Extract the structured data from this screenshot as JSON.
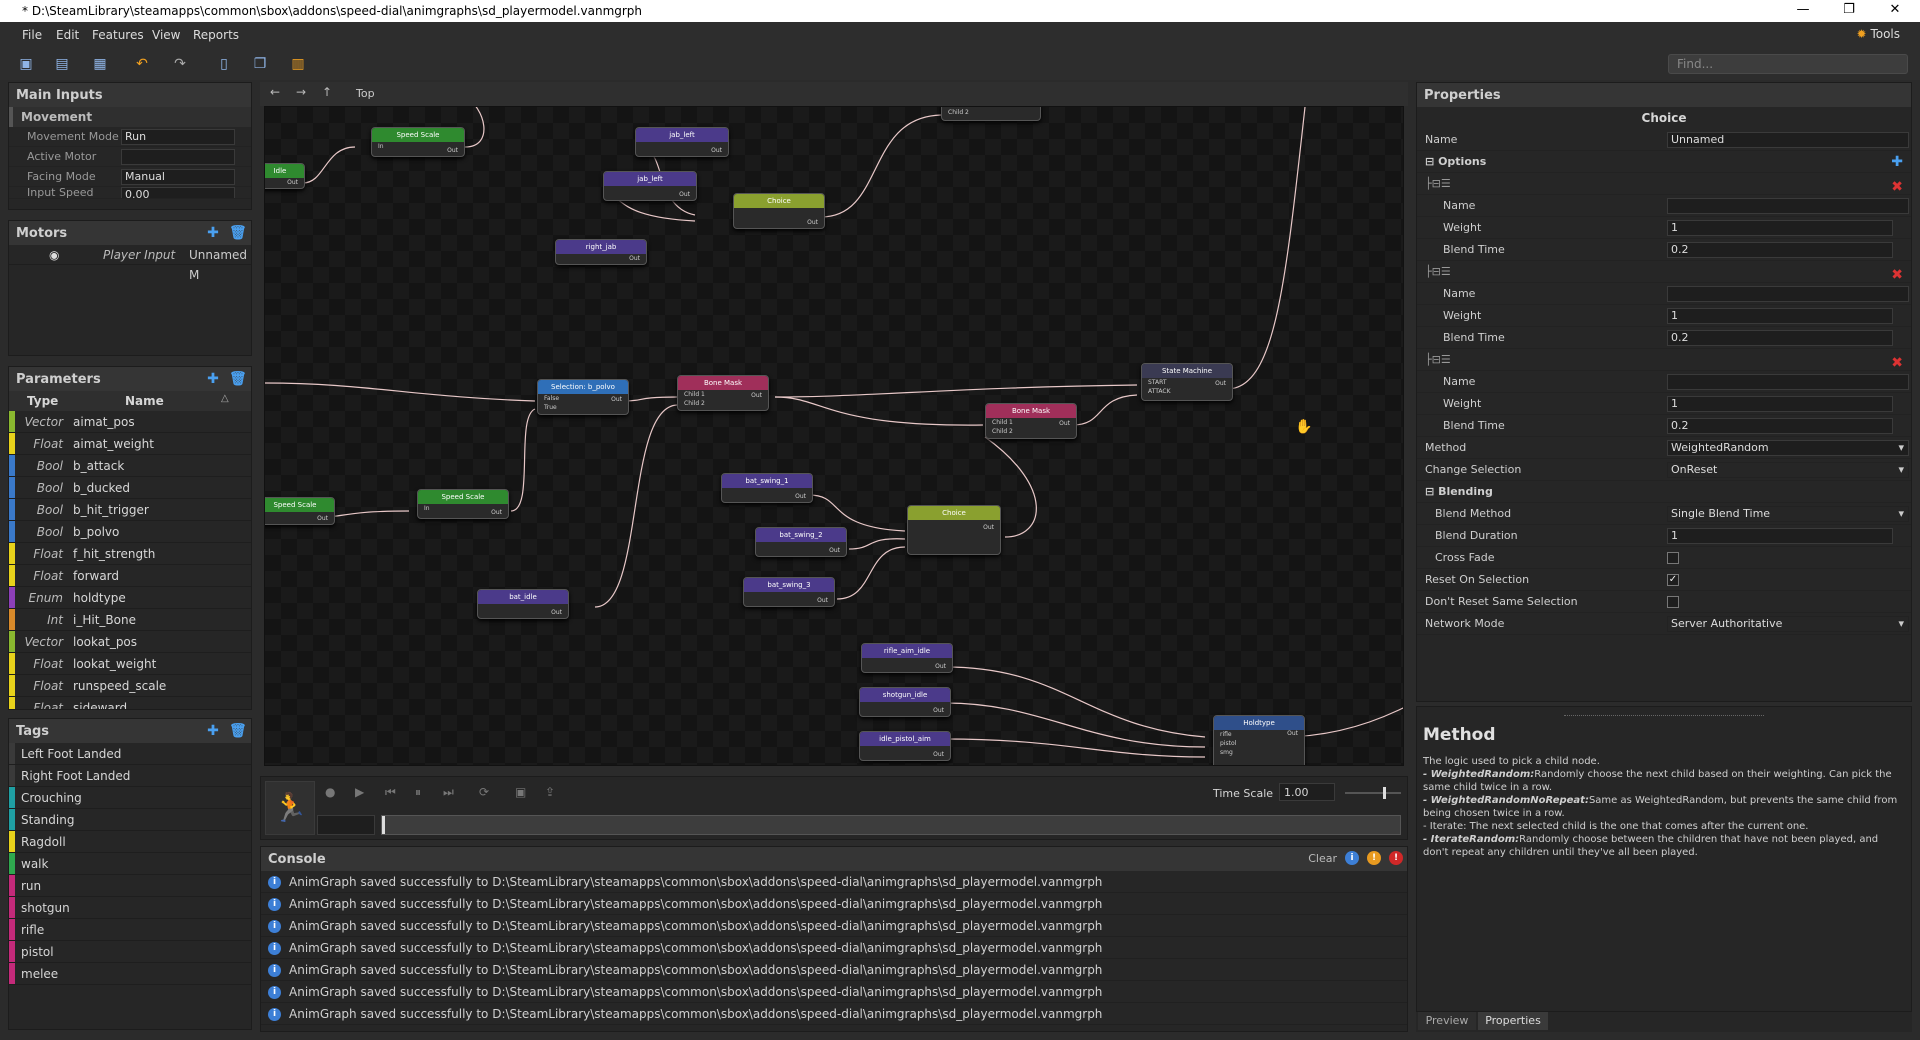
{
  "titlebar": {
    "title": "* D:\\SteamLibrary\\steamapps\\common\\sbox\\addons\\speed-dial\\animgraphs\\sd_playermodel.vanmgrph",
    "minimize": "—",
    "restore": "❐",
    "close": "✕"
  },
  "menu": {
    "items": [
      "File",
      "Edit",
      "Features",
      "View",
      "Reports"
    ],
    "tools": "Tools"
  },
  "find": {
    "placeholder": "Find..."
  },
  "main_inputs": {
    "title": "Main Inputs",
    "section": "Movement",
    "rows": [
      {
        "label": "Movement Mode",
        "value": "Run"
      },
      {
        "label": "Active Motor",
        "value": ""
      },
      {
        "label": "Facing Mode",
        "value": "Manual"
      },
      {
        "label": "Input Speed",
        "value": "0.00"
      }
    ]
  },
  "motors": {
    "title": "Motors",
    "row": {
      "name": "Player Input",
      "value": "Unnamed M"
    }
  },
  "parameters": {
    "title": "Parameters",
    "col_type": "Type",
    "col_name": "Name",
    "items": [
      {
        "type": "Vector",
        "name": "aimat_pos",
        "color": "#8ab82f"
      },
      {
        "type": "Float",
        "name": "aimat_weight",
        "color": "#e8d21b"
      },
      {
        "type": "Bool",
        "name": "b_attack",
        "color": "#3a79c9"
      },
      {
        "type": "Bool",
        "name": "b_ducked",
        "color": "#3a79c9"
      },
      {
        "type": "Bool",
        "name": "b_hit_trigger",
        "color": "#3a79c9"
      },
      {
        "type": "Bool",
        "name": "b_polvo",
        "color": "#3a79c9"
      },
      {
        "type": "Float",
        "name": "f_hit_strength",
        "color": "#e8d21b"
      },
      {
        "type": "Float",
        "name": "forward",
        "color": "#e8d21b"
      },
      {
        "type": "Enum",
        "name": "holdtype",
        "color": "#8d3fb8"
      },
      {
        "type": "Int",
        "name": "i_Hit_Bone",
        "color": "#d88a2a"
      },
      {
        "type": "Vector",
        "name": "lookat_pos",
        "color": "#8ab82f"
      },
      {
        "type": "Float",
        "name": "lookat_weight",
        "color": "#e8d21b"
      },
      {
        "type": "Float",
        "name": "runspeed_scale",
        "color": "#e8d21b"
      },
      {
        "type": "Float",
        "name": "sideward",
        "color": "#e8d21b"
      }
    ]
  },
  "tags": {
    "title": "Tags",
    "items": [
      {
        "name": "Left Foot Landed",
        "color": "#3a3a3a"
      },
      {
        "name": "Right Foot Landed",
        "color": "#3a3a3a"
      },
      {
        "name": "Crouching",
        "color": "#1f9fa3"
      },
      {
        "name": "Standing",
        "color": "#1f9fa3"
      },
      {
        "name": "Ragdoll",
        "color": "#e8d21b"
      },
      {
        "name": "walk",
        "color": "#2fa84e"
      },
      {
        "name": "run",
        "color": "#c42a7a"
      },
      {
        "name": "shotgun",
        "color": "#c42a7a"
      },
      {
        "name": "rifle",
        "color": "#c42a7a"
      },
      {
        "name": "pistol",
        "color": "#c42a7a"
      },
      {
        "name": "melee",
        "color": "#c42a7a"
      }
    ]
  },
  "graph": {
    "breadcrumb": "Top",
    "nodes": [
      {
        "id": "n1",
        "title": "Speed Scale",
        "color": "#2f8a2f",
        "ports": [
          "In"
        ]
      },
      {
        "id": "n2",
        "title": "jab_left",
        "color": "#4b3a8a",
        "ports": []
      },
      {
        "id": "n3",
        "title": "jab_left",
        "color": "#4b3a8a",
        "ports": []
      },
      {
        "id": "n4",
        "title": "Choice",
        "color": "#8aa02f",
        "ports": []
      },
      {
        "id": "n5",
        "title": "right_jab",
        "color": "#4b3a8a",
        "ports": []
      },
      {
        "id": "n6",
        "title": "Selection: b_polvo",
        "color": "#2f6fb8",
        "ports": [
          "False",
          "True"
        ]
      },
      {
        "id": "n7",
        "title": "Bone Mask",
        "color": "#a02f5a",
        "ports": [
          "Child 1",
          "Child 2"
        ]
      },
      {
        "id": "n8",
        "title": "Bone Mask",
        "color": "#a02f5a",
        "ports": [
          "Child 1",
          "Child 2"
        ]
      },
      {
        "id": "n9",
        "title": "State Machine",
        "color": "#3a3a52",
        "ports": [
          "START",
          "ATTACK"
        ]
      },
      {
        "id": "n10",
        "title": "Speed Scale",
        "color": "#2f8a2f",
        "ports": []
      },
      {
        "id": "n11",
        "title": "Speed Scale",
        "color": "#2f8a2f",
        "ports": [
          "In"
        ]
      },
      {
        "id": "n12",
        "title": "bat_swing_1",
        "color": "#4b3a8a",
        "ports": []
      },
      {
        "id": "n13",
        "title": "bat_swing_2",
        "color": "#4b3a8a",
        "ports": []
      },
      {
        "id": "n14",
        "title": "Choice",
        "color": "#8aa02f",
        "ports": []
      },
      {
        "id": "n15",
        "title": "bat_swing_3",
        "color": "#4b3a8a",
        "ports": []
      },
      {
        "id": "n16",
        "title": "bat_idle",
        "color": "#4b3a8a",
        "ports": []
      },
      {
        "id": "n17",
        "title": "rifle_aim_idle",
        "color": "#4b3a8a",
        "ports": []
      },
      {
        "id": "n18",
        "title": "shotgun_idle",
        "color": "#4b3a8a",
        "ports": []
      },
      {
        "id": "n19",
        "title": "idle_pistol_aim",
        "color": "#4b3a8a",
        "ports": []
      },
      {
        "id": "n20",
        "title": "Holdtype",
        "color": "#2f4f8a",
        "ports": [
          "rifle",
          "pistol",
          "smg"
        ]
      },
      {
        "id": "n21",
        "title": "Idle",
        "color": "#2f8a2f",
        "ports": []
      },
      {
        "id": "n22",
        "title": "",
        "color": "#3a3a3a",
        "ports": [
          "Child 2"
        ]
      }
    ],
    "out_label": "Out"
  },
  "playback": {
    "time_scale_label": "Time Scale",
    "time_scale": "1.00"
  },
  "console": {
    "title": "Console",
    "clear": "Clear",
    "message": "AnimGraph saved successfully to D:\\SteamLibrary\\steamapps\\common\\sbox\\addons\\speed-dial\\animgraphs\\sd_playermodel.vanmgrph",
    "count": 7
  },
  "properties": {
    "title": "Properties",
    "node_title": "Choice",
    "name_label": "Name",
    "name_value": "Unnamed",
    "options_label": "Options",
    "options": [
      {
        "name": "",
        "weight": "1",
        "blend": "0.2"
      },
      {
        "name": "",
        "weight": "1",
        "blend": "0.2"
      },
      {
        "name": "",
        "weight": "1",
        "blend": "0.2"
      }
    ],
    "opt_name": "Name",
    "opt_weight": "Weight",
    "opt_blend": "Blend Time",
    "method_label": "Method",
    "method_value": "WeightedRandom",
    "change_label": "Change Selection",
    "change_value": "OnReset",
    "blending_label": "Blending",
    "blend_method_label": "Blend Method",
    "blend_method_value": "Single Blend Time",
    "blend_duration_label": "Blend Duration",
    "blend_duration_value": "1",
    "cross_fade_label": "Cross Fade",
    "reset_label": "Reset On Selection",
    "dont_reset_label": "Don't Reset Same Selection",
    "network_label": "Network Mode",
    "network_value": "Server Authoritative"
  },
  "help": {
    "title": "Method",
    "intro": "The logic used to pick a child node.",
    "l1k": "- WeightedRandom:",
    "l1": "Randomly choose the next child based on their weighting. Can pick the same child twice in a row.",
    "l2k": "- WeightedRandomNoRepeat:",
    "l2": "Same as WeightedRandom, but prevents the same child from being chosen twice in a row.",
    "l3": "- Iterate: The next selected child is the one that comes after the current one.",
    "l4k": "- IterateRandom:",
    "l4": "Randomly choose between the children that have not been played, and don't repeat any children until they've all been played."
  },
  "bottom_tabs": [
    "Preview",
    "Properties"
  ]
}
